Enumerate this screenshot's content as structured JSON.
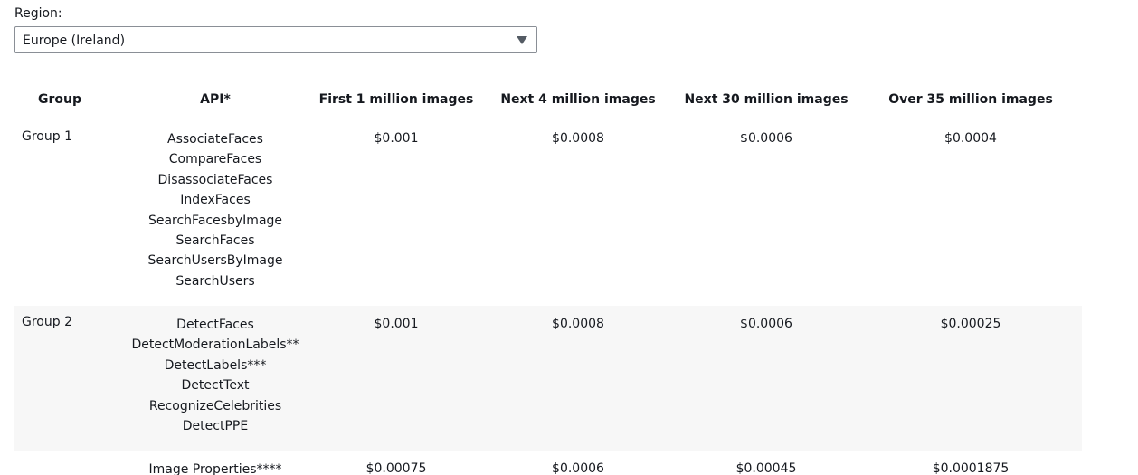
{
  "region": {
    "label": "Region:",
    "selected": "Europe (Ireland)"
  },
  "table": {
    "headers": {
      "group": "Group",
      "api": "API*",
      "tier1": "First 1 million images",
      "tier2": "Next 4 million images",
      "tier3": "Next 30 million images",
      "tier4": "Over 35 million images"
    },
    "rows": [
      {
        "group": "Group 1",
        "apis": [
          "AssociateFaces",
          "CompareFaces",
          "DisassociateFaces",
          "IndexFaces",
          "SearchFacesbyImage",
          "SearchFaces",
          "SearchUsersByImage",
          "SearchUsers"
        ],
        "prices": [
          "$0.001",
          "$0.0008",
          "$0.0006",
          "$0.0004"
        ]
      },
      {
        "group": "Group 2",
        "apis": [
          "DetectFaces",
          "DetectModerationLabels**",
          "DetectLabels***",
          "DetectText",
          "RecognizeCelebrities",
          "DetectPPE"
        ],
        "prices": [
          "$0.001",
          "$0.0008",
          "$0.0006",
          "$0.00025"
        ]
      },
      {
        "group": "",
        "apis": [
          "Image Properties****"
        ],
        "prices": [
          "$0.00075",
          "$0.0006",
          "$0.00045",
          "$0.0001875"
        ]
      }
    ]
  }
}
